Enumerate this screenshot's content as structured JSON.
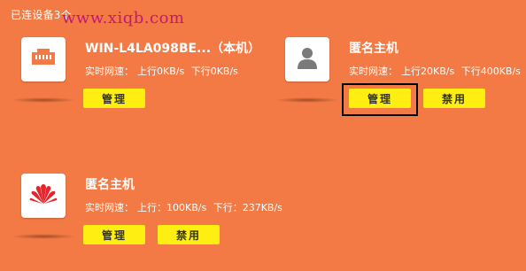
{
  "header": {
    "connected_label": "已连设备3个",
    "watermark": "www.xiqb.com"
  },
  "devices": [
    {
      "name": "WIN-L4LA098BE...（本机）",
      "icon": "ethernet-port-icon",
      "speed_label": "实时网速：",
      "up_label": "上行0KB/s",
      "down_label": "下行0KB/s",
      "buttons": {
        "manage": "管理"
      }
    },
    {
      "name": "匿名主机",
      "icon": "person-avatar-icon",
      "speed_label": "实时网速：",
      "up_label": "上行20KB/s",
      "down_label": "下行400KB/s",
      "buttons": {
        "manage": "管理",
        "block": "禁用"
      }
    },
    {
      "name": "匿名主机",
      "icon": "huawei-logo-icon",
      "speed_label": "实时网速：",
      "up_label": "上行：100KB/s",
      "down_label": "下行：237KB/s",
      "buttons": {
        "manage": "管理",
        "block": "禁用"
      }
    }
  ],
  "colors": {
    "background": "#f37a45",
    "button": "#ffee11",
    "watermark": "#c2187a",
    "huawei_red": "#e4262c"
  }
}
